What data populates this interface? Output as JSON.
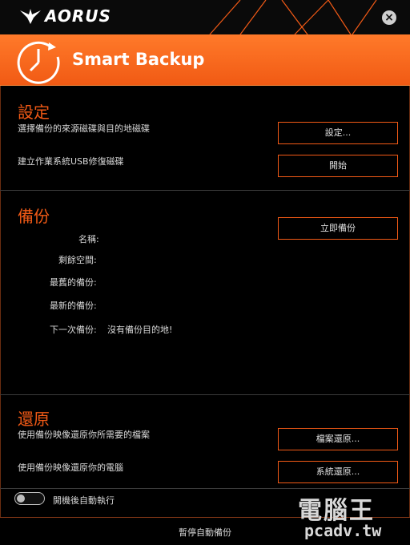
{
  "app": {
    "brand": "AORUS",
    "title": "Smart Backup",
    "close_glyph": "×"
  },
  "colors": {
    "accent": "#f25a16",
    "background": "#000000",
    "text": "#d8d8d8"
  },
  "settings": {
    "title": "設定",
    "select_text": "選擇備份的來源磁碟與目的地磁碟",
    "select_button": "設定...",
    "usb_text": "建立作業系統USB修復磁碟",
    "usb_button": "開始"
  },
  "backup": {
    "title": "備份",
    "now_button": "立即備份",
    "fields": {
      "name_label": "名稱:",
      "space_label": "剩餘空間:",
      "oldest_label": "最舊的備份:",
      "newest_label": "最新的備份:",
      "next_label": "下一次備份:",
      "next_value": "沒有備份目的地!"
    }
  },
  "restore": {
    "title": "還原",
    "file_text": "使用備份映像還原你所需要的檔案",
    "file_button": "檔案還原...",
    "system_text": "使用備份映像還原你的電腦",
    "system_button": "系統還原..."
  },
  "autostart": {
    "label": "開機後自動執行",
    "enabled": false
  },
  "footer": {
    "pause_label": "暫停自動備份"
  },
  "watermark": {
    "cn": "電腦王",
    "url": "pcadv.tw"
  }
}
